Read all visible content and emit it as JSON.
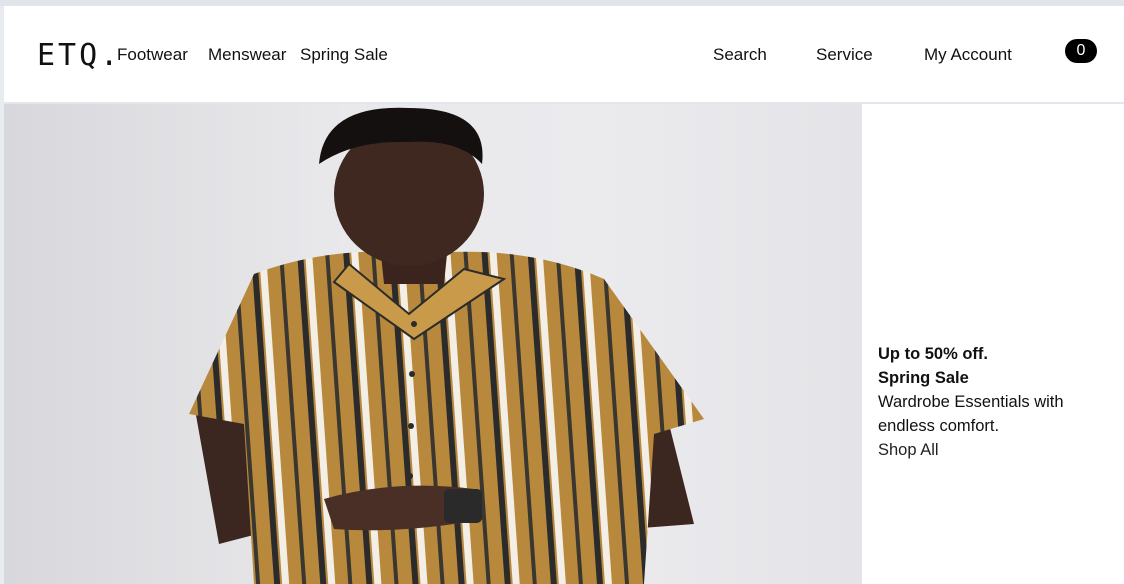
{
  "header": {
    "logo": "ETQ.",
    "nav_left": [
      "Footwear",
      "Menswear",
      "Spring Sale"
    ],
    "nav_right": [
      "Search",
      "Service",
      "My Account"
    ],
    "cart_count": "0"
  },
  "hero": {
    "image_alt": "Man in mustard striped short-sleeve shirt"
  },
  "promo": {
    "headline": "Up to 50% off.",
    "subhead": "Spring Sale",
    "line1": "Wardrobe Essentials with",
    "line2": "endless comfort.",
    "cta": "Shop All"
  },
  "colors": {
    "shirt": "#b8893c",
    "accent": "#000000"
  }
}
